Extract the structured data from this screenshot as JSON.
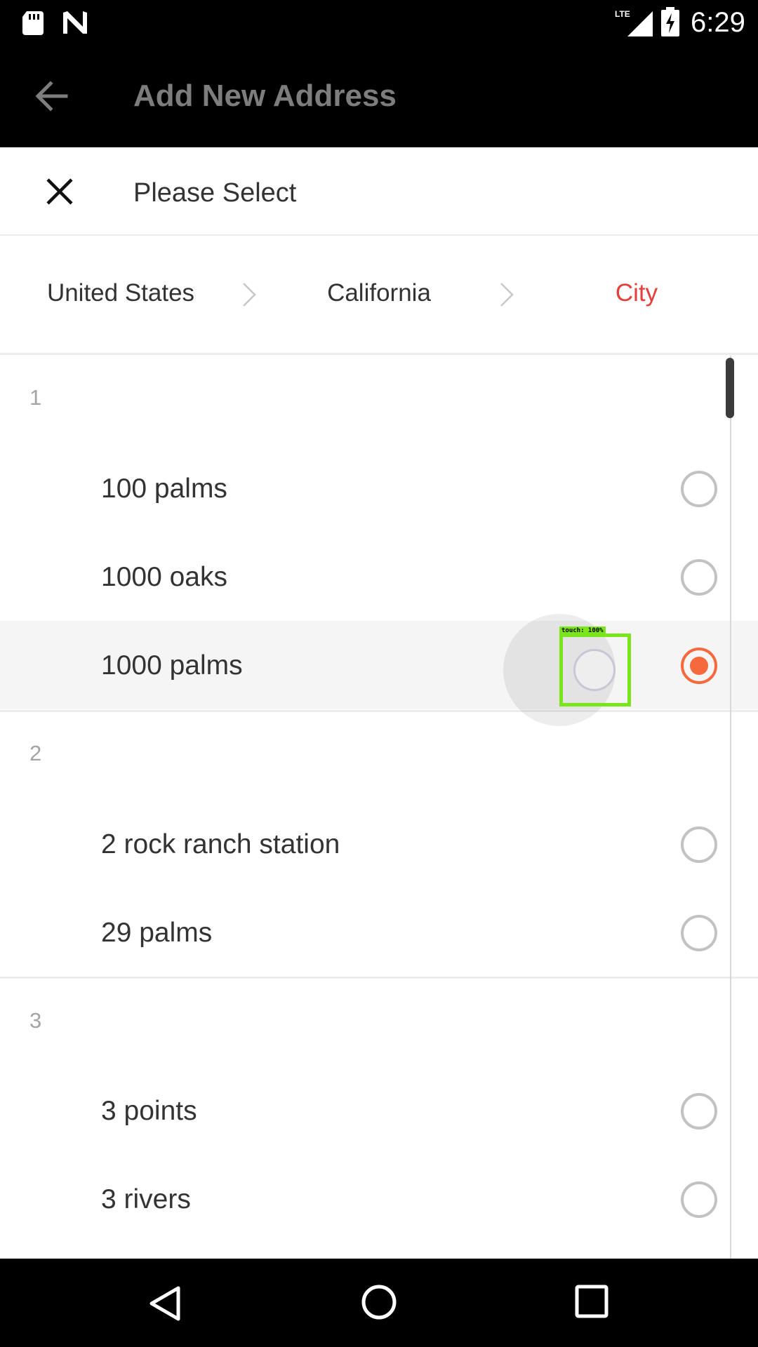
{
  "status_bar": {
    "time": "6:29",
    "network": "LTE",
    "icons": [
      "sd-card-icon",
      "n-notification-icon",
      "signal-icon",
      "battery-charging-icon"
    ]
  },
  "app_bar": {
    "title": "Add New Address",
    "back_icon": "arrow-back-icon"
  },
  "sheet": {
    "title": "Please Select",
    "close_icon": "close-icon",
    "breadcrumb": [
      "United States",
      "California",
      "City"
    ],
    "active_crumb_color": "#e4403b",
    "groups": [
      {
        "header": "1",
        "items": [
          {
            "label": "100 palms",
            "selected": false
          },
          {
            "label": "1000 oaks",
            "selected": false
          },
          {
            "label": "1000 palms",
            "selected": true
          }
        ]
      },
      {
        "header": "2",
        "items": [
          {
            "label": "2 rock ranch station",
            "selected": false
          },
          {
            "label": "29 palms",
            "selected": false
          }
        ]
      },
      {
        "header": "3",
        "items": [
          {
            "label": "3 points",
            "selected": false
          },
          {
            "label": "3 rivers",
            "selected": false
          }
        ]
      }
    ],
    "radio_selected_color": "#f5693c"
  },
  "touch_overlay": {
    "label": "touch: 100%",
    "color": "#7ae51a"
  },
  "nav_bar": {
    "icons": [
      "nav-back-icon",
      "nav-home-icon",
      "nav-recents-icon"
    ]
  }
}
